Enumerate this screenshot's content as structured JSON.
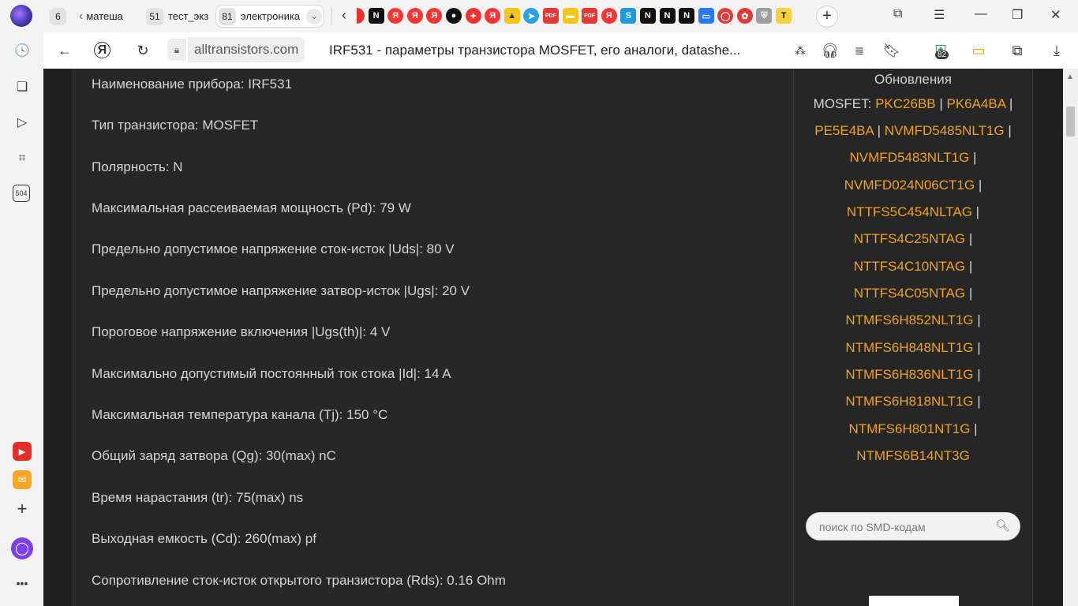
{
  "tabs": [
    {
      "count": "6",
      "label": ""
    },
    {
      "count": "",
      "label": "матеша"
    },
    {
      "count": "51",
      "label": "тест_экз"
    },
    {
      "count": "81",
      "label": "электроника"
    }
  ],
  "address": {
    "domain": "alltransistors.com",
    "title": "IRF531 - параметры транзистора MOSFET, его аналоги, datashe...",
    "shield_count": "82"
  },
  "sidebar": {
    "counter": "504"
  },
  "specs": [
    "Наименование прибора: IRF531",
    "Тип транзистора: MOSFET",
    "Полярность: N",
    "Максимальная рассеиваемая мощность (Pd): 79 W",
    "Предельно допустимое напряжение сток-исток |Uds|: 80 V",
    "Предельно допустимое напряжение затвор-исток |Ugs|: 20 V",
    "Пороговое напряжение включения |Ugs(th)|: 4 V",
    "Максимально допустимый постоянный ток стока |Id|: 14 A",
    "Максимальная температура канала (Tj): 150 °C",
    "Общий заряд затвора (Qg): 30(max) nC",
    "Время нарастания (tr): 75(max) ns",
    "Выходная емкость (Cd): 260(max) pf",
    "Сопротивление сток-исток открытого транзистора (Rds): 0.16 Ohm"
  ],
  "updates": {
    "title": "Обновления",
    "prefix": "MOSFET: ",
    "separator": " | ",
    "links": [
      "PKC26BB",
      "PK6A4BA",
      "PE5E4BA",
      "NVMFD5485NLT1G",
      "NVMFD5483NLT1G",
      "NVMFD024N06CT1G",
      "NTTFS5C454NLTAG",
      "NTTFS4C25NTAG",
      "NTTFS4C10NTAG",
      "NTTFS4C05NTAG",
      "NTMFS6H852NLT1G",
      "NTMFS6H848NLT1G",
      "NTMFS6H836NLT1G",
      "NTMFS6H818NLT1G",
      "NTMFS6H801NT1G",
      "NTMFS6B14NT3G"
    ]
  },
  "search": {
    "placeholder": "поиск по SMD-кодам"
  },
  "colors": {
    "link": "#f0a31c",
    "text": "#d4d4d4",
    "background": "#1e1e1e"
  }
}
